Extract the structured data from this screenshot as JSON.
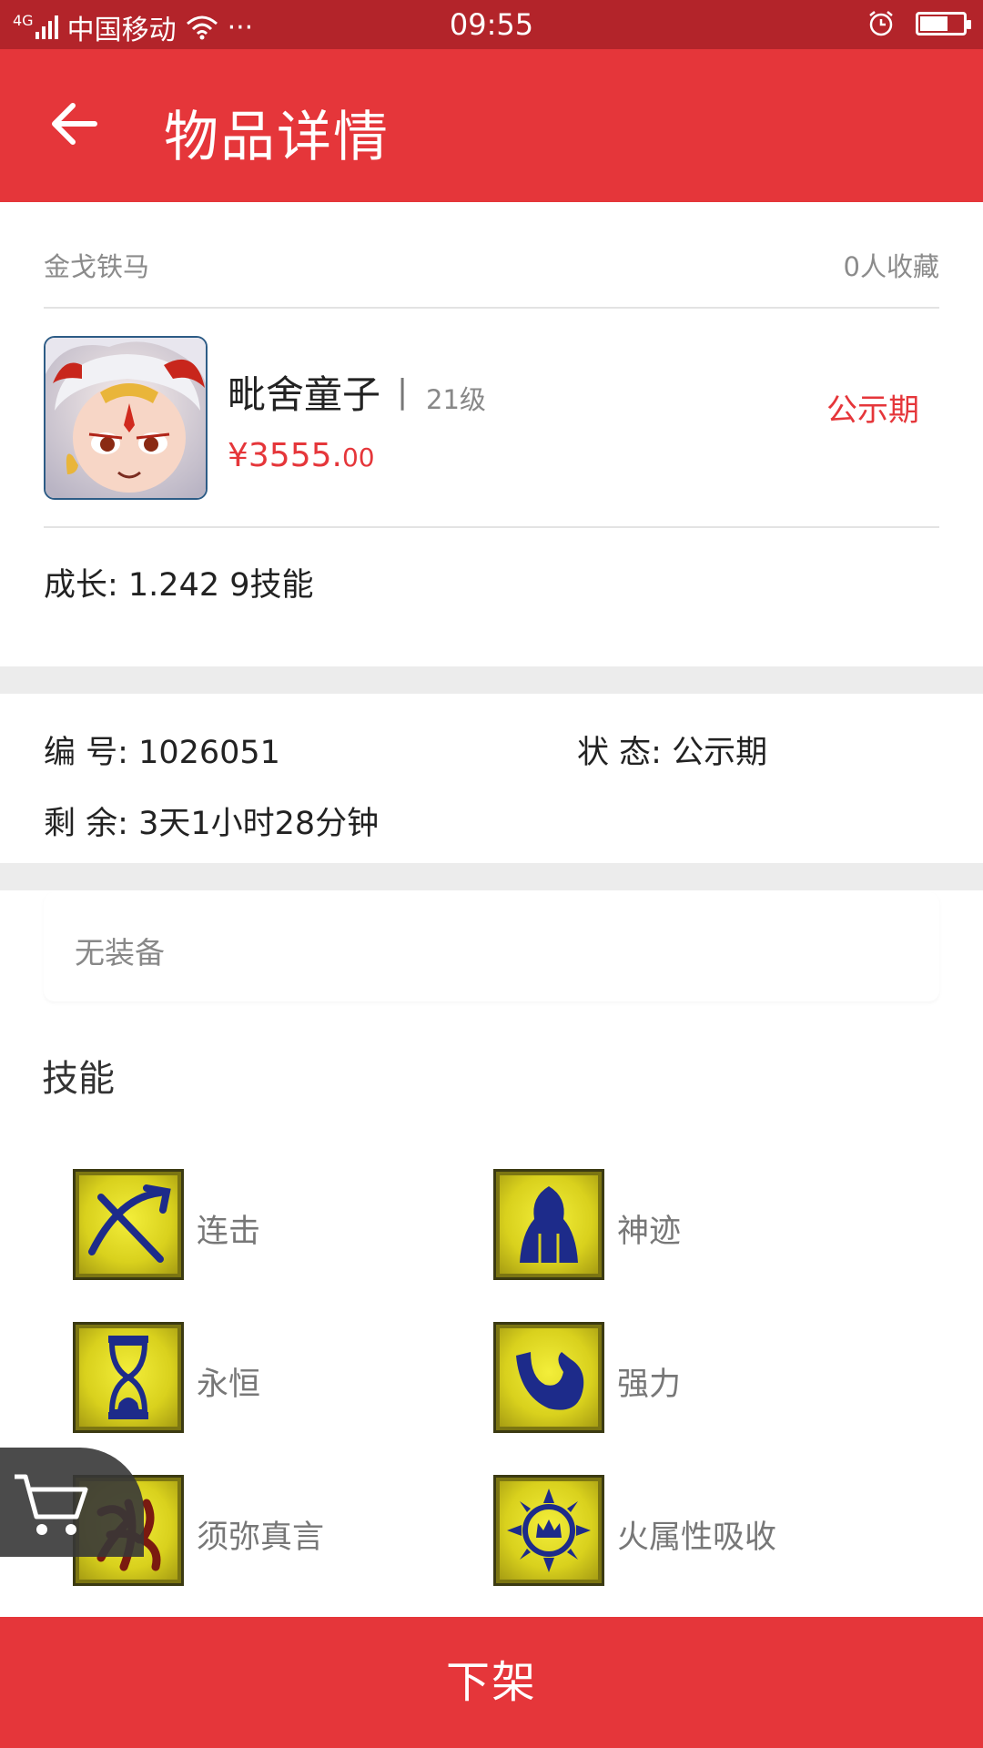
{
  "status_bar": {
    "network": "4G",
    "carrier": "中国移动",
    "more": "···",
    "time": "09:55"
  },
  "header": {
    "title": "物品详情"
  },
  "item": {
    "shop_name": "金戈铁马",
    "favorites": "0人收藏",
    "name": "毗舍童子",
    "separator": "|",
    "level": "21级",
    "price_main": "¥3555.",
    "price_cents": "00",
    "status": "公示期",
    "growth_skills": "成长: 1.242  9技能"
  },
  "details": {
    "id_label": "编  号:",
    "id_value": "1026051",
    "state_label": "状  态:",
    "state_value": "公示期",
    "remaining_label": "剩  余:",
    "remaining_value": "3天1小时28分钟"
  },
  "equipment": {
    "empty_text": "无装备"
  },
  "skills": {
    "title": "技能",
    "items": [
      {
        "name": "连击",
        "icon": "crossed-blades-icon"
      },
      {
        "name": "神迹",
        "icon": "hooded-figure-icon"
      },
      {
        "name": "永恒",
        "icon": "hourglass-icon"
      },
      {
        "name": "强力",
        "icon": "flexed-arm-icon"
      },
      {
        "name": "须弥真言",
        "icon": "rune-script-icon"
      },
      {
        "name": "火属性吸收",
        "icon": "sun-crown-icon"
      }
    ]
  },
  "actions": {
    "delist_label": "下架"
  },
  "colors": {
    "accent": "#e5363a",
    "status_bar": "#b3242a",
    "divider": "#ececec"
  }
}
